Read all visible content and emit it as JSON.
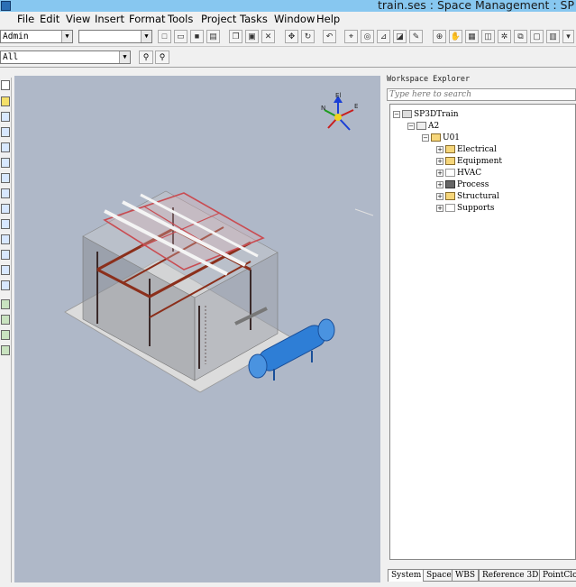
{
  "window": {
    "title": "train.ses : Space Management : SP"
  },
  "menu": [
    "File",
    "Edit",
    "View",
    "Insert",
    "Format",
    "Tools",
    "Project",
    "Tasks",
    "Window",
    "Help"
  ],
  "toolbar": {
    "permission_group": "Admin",
    "second_combo": "",
    "filter": "All"
  },
  "compass": {
    "north": "N",
    "east": "E",
    "elevation": "El"
  },
  "explorer": {
    "header": "Workspace Explorer",
    "search_placeholder": "Type here to search",
    "tree": {
      "root": "SP3DTrain",
      "area": "A2",
      "unit": "U01",
      "children": [
        "Electrical",
        "Equipment",
        "HVAC",
        "Process",
        "Structural",
        "Supports"
      ]
    },
    "tabs": [
      "System",
      "Space",
      "WBS",
      "Reference 3D",
      "PointClo"
    ]
  }
}
